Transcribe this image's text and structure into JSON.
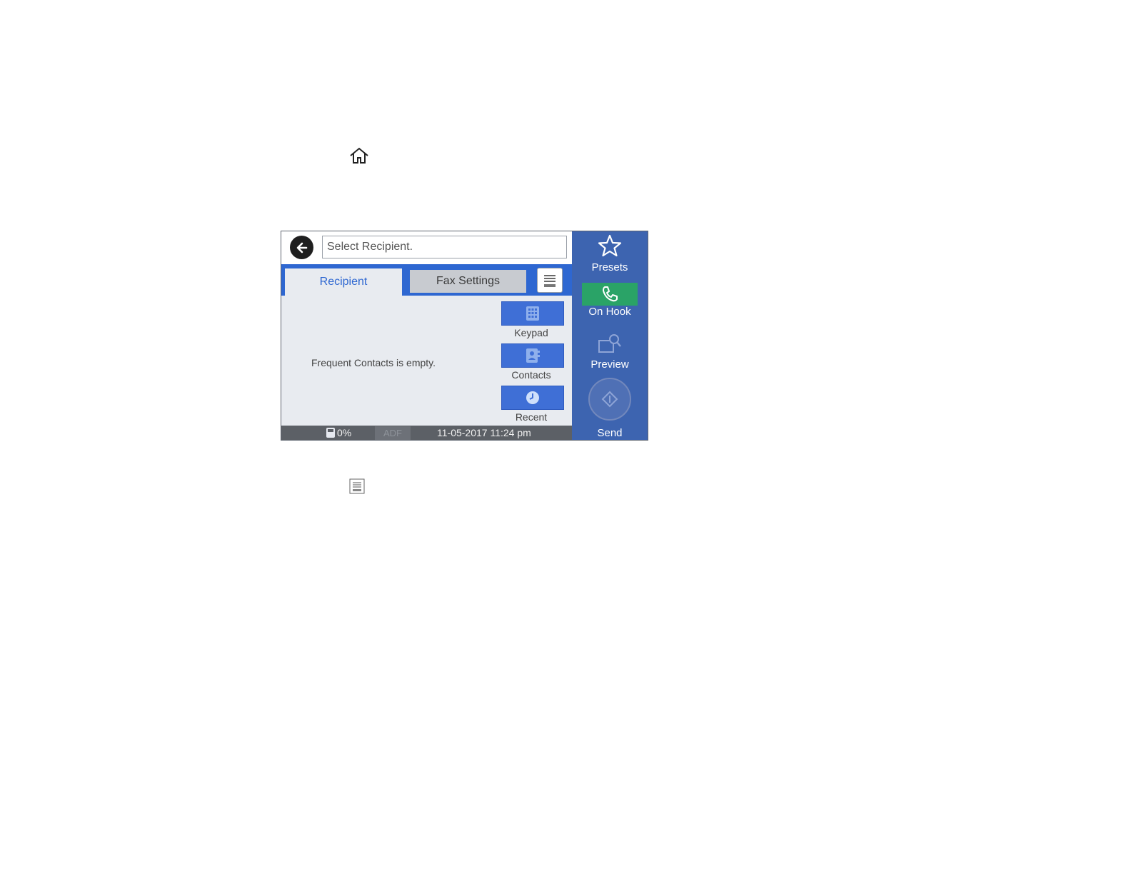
{
  "instructions": {
    "home_icon": "home-icon",
    "menu_icon": "menu-icon"
  },
  "screen": {
    "recipient_field": {
      "placeholder": "Select Recipient."
    },
    "tabs": [
      {
        "label": "Recipient",
        "active": true
      },
      {
        "label": "Fax Settings",
        "active": false
      }
    ],
    "empty_message": "Frequent Contacts is empty.",
    "actions": [
      {
        "label": "Keypad",
        "icon": "keypad-icon"
      },
      {
        "label": "Contacts",
        "icon": "contacts-icon"
      },
      {
        "label": "Recent",
        "icon": "clock-icon"
      }
    ],
    "status": {
      "ink": "0%",
      "source": "ADF",
      "datetime": "11-05-2017 11:24 pm"
    },
    "sidebar": {
      "presets": "Presets",
      "on_hook": "On Hook",
      "preview": "Preview",
      "send": "Send"
    },
    "colors": {
      "accent": "#2e67d1",
      "sidebar": "#3d64b0",
      "on_hook": "#2aa367"
    }
  }
}
